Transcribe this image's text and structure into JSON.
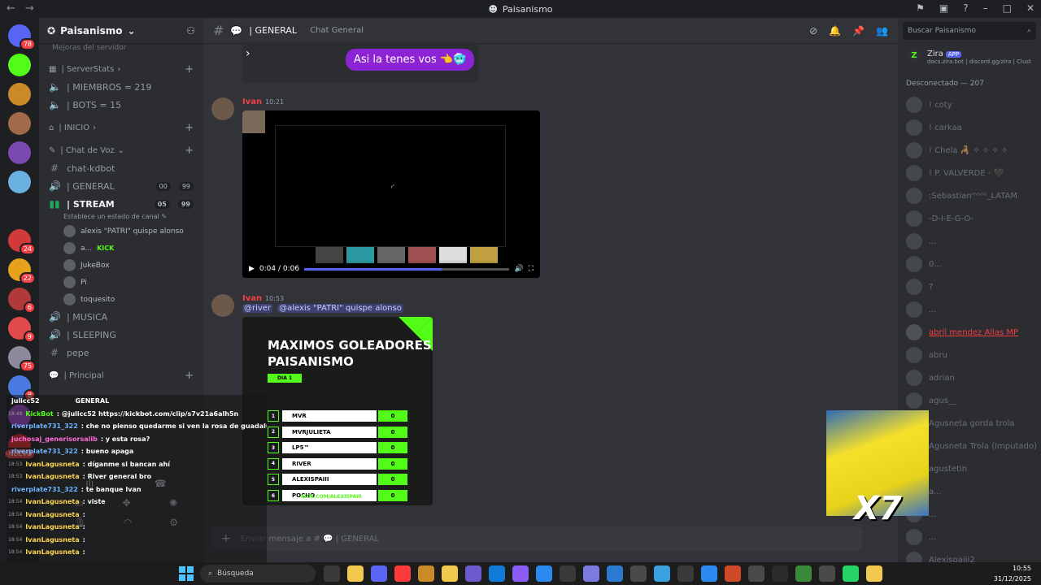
{
  "titlebar": {
    "title": "Paisanismo"
  },
  "rail": {
    "servers": [
      {
        "color": "#5865f2",
        "badge": "78"
      },
      {
        "color": "#53fc18",
        "badge": ""
      },
      {
        "color": "#c98a2a",
        "badge": ""
      },
      {
        "color": "#a06a4a",
        "badge": ""
      },
      {
        "color": "#7a4ab0",
        "badge": ""
      },
      {
        "color": "#6ab0e0",
        "badge": ""
      },
      {
        "color": "#1e1f22",
        "badge": ""
      },
      {
        "color": "#d23a3a",
        "badge": "24"
      },
      {
        "color": "#e6a21a",
        "badge": "22"
      },
      {
        "color": "#b03a3a",
        "badge": "6"
      },
      {
        "color": "#e04a4a",
        "badge": "9"
      },
      {
        "color": "#8a8a9a",
        "badge": "75"
      },
      {
        "color": "#4a7ae0",
        "badge": "8"
      },
      {
        "color": "#a04ad0",
        "badge": ""
      },
      {
        "color": "#e02a2a",
        "badge": "NUEVO"
      }
    ]
  },
  "sidebar": {
    "guild_name": "Paisanismo",
    "faded_channel": "Mejoras del servidor",
    "cat_serverstats": "| ServerStats",
    "miembros": "| MIEMBROS = 219",
    "bots": "| BOTS = 15",
    "cat_inicio": "| INICIO",
    "cat_voz": "| Chat de Voz",
    "chat_kdbot": "chat-kdbot",
    "general": "| GENERAL",
    "general_count": "00",
    "general_count2": "99",
    "stream": "| STREAM",
    "stream_count": "05",
    "stream_count2": "99",
    "stream_status": "Establece un estado de canal",
    "voice_members": [
      {
        "name": "alexis \"PATRI\" quispe alonso",
        "extra": ""
      },
      {
        "name": "a...",
        "extra": "KICK"
      },
      {
        "name": "JukeBox",
        "extra": ""
      },
      {
        "name": "Pi",
        "extra": ""
      },
      {
        "name": "toquesito",
        "extra": ""
      }
    ],
    "musica": "| MUSICA",
    "sleeping": "| SLEEPING",
    "pepe": "pepe",
    "cat_principal": "| Principal"
  },
  "chat_overlay": {
    "header_user": "julicc52",
    "header_channel": "GENERAL",
    "lines": [
      {
        "time": "",
        "user": "julicc52",
        "color": "#ffffff",
        "text": ""
      },
      {
        "time": "18:49",
        "user": "KickBot",
        "color": "#53fc18",
        "text": ": @julicc52 https://kickbot.com/clip/s7v21a6alh5n"
      },
      {
        "time": "",
        "user": "riverplate731_322",
        "color": "#6fb3ff",
        "text": ": che no pienso quedarme si ven la rosa de guadalupe"
      },
      {
        "time": "",
        "user": "juchosaj_generisorsalib",
        "color": "#ff6ad5",
        "text": ": y esta rosa?"
      },
      {
        "time": "",
        "user": "riverplate731_322",
        "color": "#6fb3ff",
        "text": ": bueno apaga"
      },
      {
        "time": "18:53",
        "user": "IvanLagusneta",
        "color": "#ffd34d",
        "text": ": díganme si bancan ahí"
      },
      {
        "time": "18:53",
        "user": "IvanLagusneta",
        "color": "#ffd34d",
        "text": ": River general bro"
      },
      {
        "time": "",
        "user": "riverplate731_322",
        "color": "#6fb3ff",
        "text": ": te banque Ivan"
      },
      {
        "time": "18:54",
        "user": "IvanLagusneta",
        "color": "#ffd34d",
        "text": ": viste"
      },
      {
        "time": "18:54",
        "user": "IvanLagusneta",
        "color": "#ffd34d",
        "text": ":"
      },
      {
        "time": "18:54",
        "user": "IvanLagusneta",
        "color": "#ffd34d",
        "text": ":"
      },
      {
        "time": "18:54",
        "user": "IvanLagusneta",
        "color": "#ffd34d",
        "text": ":"
      },
      {
        "time": "18:54",
        "user": "IvanLagusneta",
        "color": "#ffd34d",
        "text": ":"
      },
      {
        "time": "18:54",
        "user": "IvanLagusneta",
        "color": "#ffd34d",
        "text": ":"
      },
      {
        "time": "18:54",
        "user": "IvanLagusneta",
        "color": "#ffd34d",
        "text": ":"
      }
    ]
  },
  "header": {
    "channel": "| GENERAL",
    "topic": "Chat General",
    "search_placeholder": "Buscar Paisanismo"
  },
  "messages": {
    "pill_text": "Asi la tenes vos 👈🥶",
    "msg1_author": "Ivan",
    "msg1_time": "10:21",
    "video_time": "0:04 / 0:06",
    "video_progress": 0.67,
    "msg2_author": "Ivan",
    "msg2_time": "10:53",
    "mention1": "@river",
    "mention2": "@alexis \"PATRI\" quispe alonso"
  },
  "poster": {
    "title1": "MAXIMOS GOLEADORES",
    "title2": "PAISANISMO",
    "dia": "DIA 1",
    "rows": [
      {
        "n": "1",
        "name": "MVR",
        "score": "0"
      },
      {
        "n": "2",
        "name": "MVRJULIETA",
        "score": "0"
      },
      {
        "n": "3",
        "name": "LP5™",
        "score": "0"
      },
      {
        "n": "4",
        "name": "RIVER",
        "score": "0"
      },
      {
        "n": "5",
        "name": "ALEXISPAIII",
        "score": "0"
      },
      {
        "n": "6",
        "name": "POCHO",
        "score": "0"
      }
    ],
    "footer": "KICK.COM/ALEXISPAIII"
  },
  "composer": {
    "placeholder": "Enviar mensaje a # 💬 | GENERAL"
  },
  "members": {
    "zira_name": "Zira",
    "zira_app": "APP",
    "zira_sub": "docs.zira.bot | discord.gg/zira | Clust",
    "offline_header": "Desconectado — 207",
    "list": [
      {
        "name": "! coty",
        "highlight": false
      },
      {
        "name": "! carkaa",
        "highlight": false
      },
      {
        "name": "! Chela 🦂 ✧ ✧ ✧ ✧",
        "highlight": false
      },
      {
        "name": "! P. VALVERDE - 🖤",
        "highlight": false
      },
      {
        "name": ":Sebastianᵐᵒᵒᵒ_LATAM",
        "highlight": false
      },
      {
        "name": "-D-I-E-G-O-",
        "highlight": false
      },
      {
        "name": "...",
        "highlight": false
      },
      {
        "name": "0...",
        "highlight": false
      },
      {
        "name": "?",
        "highlight": false
      },
      {
        "name": "...",
        "highlight": false
      },
      {
        "name": "abril mendez Alias MP",
        "highlight": true
      },
      {
        "name": "abru",
        "highlight": false
      },
      {
        "name": "adrian",
        "highlight": false
      },
      {
        "name": "agus__",
        "highlight": false
      },
      {
        "name": "Agusneta gorda trola",
        "highlight": false
      },
      {
        "name": "Agusneta Trola (Imputado)",
        "highlight": false
      },
      {
        "name": "agustetin",
        "highlight": false
      },
      {
        "name": "a...",
        "highlight": false
      },
      {
        "name": "...",
        "highlight": false
      },
      {
        "name": "...",
        "highlight": false
      },
      {
        "name": "Alexispaiii2",
        "highlight": false
      }
    ]
  },
  "overlay": {
    "x7": "X7"
  },
  "taskbar": {
    "search": "Búsqueda",
    "time": "10:55",
    "date": "31/12/2025",
    "apps": [
      "#3a3a3a",
      "#f2c94c",
      "#5865f2",
      "#ff3a3a",
      "#c98a2a",
      "#f2c94c",
      "#6a5acd",
      "#0f7ad8",
      "#8a5cf6",
      "#2a8af0",
      "#3a3a3a",
      "#7a7ae0",
      "#2a7ad0",
      "#4a4a4a",
      "#3aa0e0",
      "#3a3a3a",
      "#2a8af0",
      "#d04a2a",
      "#4a4a4a",
      "#2a2a2a",
      "#3a8a3a",
      "#4a4a4a",
      "#25d366",
      "#f2c94c"
    ]
  }
}
